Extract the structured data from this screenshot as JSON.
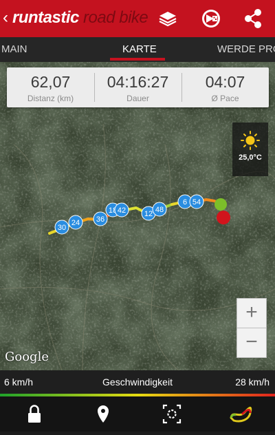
{
  "appbar": {
    "back_glyph": "‹",
    "brand_part1": "runtastic",
    "brand_part2": " road bike",
    "actions": [
      "stack-icon",
      "share-track-icon",
      "share-icon"
    ]
  },
  "tabs": [
    {
      "label": "MAIN",
      "active": false
    },
    {
      "label": "KARTE",
      "active": true
    },
    {
      "label": "WERDE PRO!",
      "active": false
    }
  ],
  "stats": [
    {
      "value": "62,07",
      "label": "Distanz (km)"
    },
    {
      "value": "04:16:27",
      "label": "Dauer"
    },
    {
      "value": "04:07",
      "label": "Ø Pace"
    }
  ],
  "weather": {
    "icon": "sun-icon",
    "temperature": "25,0°C"
  },
  "markers": [
    "30",
    "24",
    "36",
    "18",
    "42",
    "12",
    "48",
    "6",
    "54"
  ],
  "zoom": {
    "in": "+",
    "out": "−"
  },
  "map_attribution": "Google",
  "speed": {
    "min": "6 km/h",
    "label": "Geschwindigkeit",
    "max": "28 km/h"
  },
  "colors": {
    "primary": "#c4121f",
    "start": "#7cbf2a",
    "end": "#d1141c",
    "marker": "#2a8de0"
  },
  "bottom_nav": [
    "lock-icon",
    "location-pin-icon",
    "fullscreen-icon",
    "route-icon"
  ]
}
